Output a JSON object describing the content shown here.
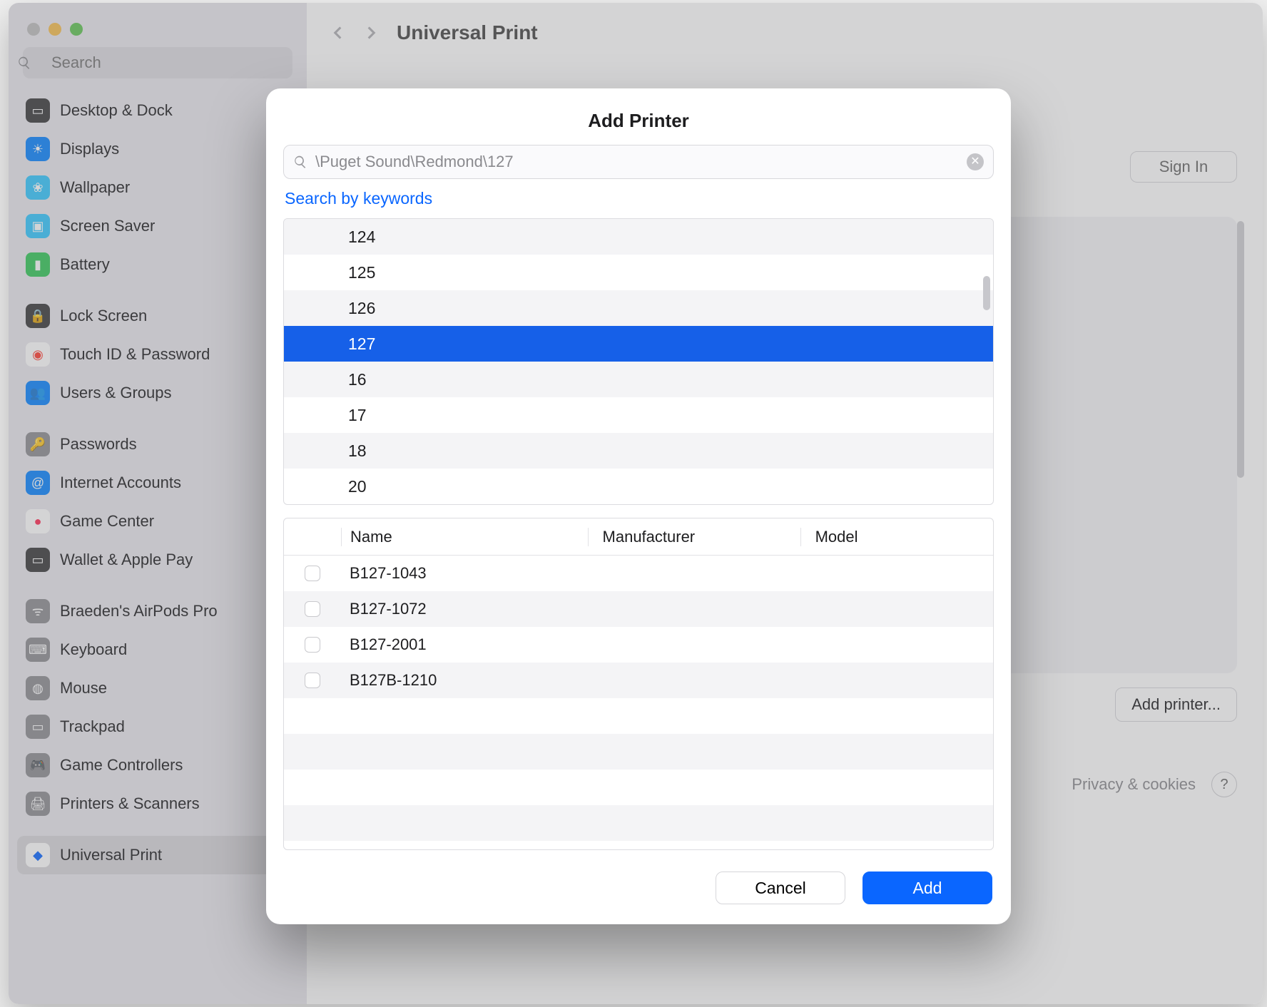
{
  "sidebar": {
    "search_placeholder": "Search",
    "items": [
      {
        "label": "Desktop & Dock",
        "bg": "#3a3a3c",
        "glyph": "▭"
      },
      {
        "label": "Displays",
        "bg": "#0a84ff",
        "glyph": "☀"
      },
      {
        "label": "Wallpaper",
        "bg": "#34c8ff",
        "glyph": "❀"
      },
      {
        "label": "Screen Saver",
        "bg": "#34c8ff",
        "glyph": "▣"
      },
      {
        "label": "Battery",
        "bg": "#34c759",
        "glyph": "▮"
      },
      {
        "gap": true
      },
      {
        "label": "Lock Screen",
        "bg": "#3a3a3c",
        "glyph": "🔒"
      },
      {
        "label": "Touch ID & Password",
        "bg": "#ffffff",
        "glyph": "◉",
        "glyphColor": "#ff3b30"
      },
      {
        "label": "Users & Groups",
        "bg": "#0a84ff",
        "glyph": "👥"
      },
      {
        "gap": true
      },
      {
        "label": "Passwords",
        "bg": "#8e8e93",
        "glyph": "🔑"
      },
      {
        "label": "Internet Accounts",
        "bg": "#0a84ff",
        "glyph": "@"
      },
      {
        "label": "Game Center",
        "bg": "#ffffff",
        "glyph": "●",
        "glyphColor": "#ff2d55"
      },
      {
        "label": "Wallet & Apple Pay",
        "bg": "#3a3a3c",
        "glyph": "▭"
      },
      {
        "gap": true
      },
      {
        "label": "Braeden's AirPods Pro",
        "bg": "#8e8e93",
        "glyph": "ᯤ"
      },
      {
        "label": "Keyboard",
        "bg": "#8e8e93",
        "glyph": "⌨"
      },
      {
        "label": "Mouse",
        "bg": "#8e8e93",
        "glyph": "◍"
      },
      {
        "label": "Trackpad",
        "bg": "#8e8e93",
        "glyph": "▭"
      },
      {
        "label": "Game Controllers",
        "bg": "#8e8e93",
        "glyph": "🎮"
      },
      {
        "label": "Printers & Scanners",
        "bg": "#8e8e93",
        "glyph": "🖨"
      },
      {
        "gap": true
      },
      {
        "label": "Universal Print",
        "bg": "#ffffff",
        "glyph": "◆",
        "glyphColor": "#0a66ff",
        "selected": true
      }
    ]
  },
  "content": {
    "title": "Universal Print",
    "signin_label": "Sign In",
    "add_printer_label": "Add printer...",
    "footer_text": "Privacy & cookies",
    "help_label": "?"
  },
  "dialog": {
    "title": "Add Printer",
    "search_value": "\\Puget Sound\\Redmond\\127",
    "keywords_link": "Search by keywords",
    "tree": [
      {
        "label": "124"
      },
      {
        "label": "125"
      },
      {
        "label": "126"
      },
      {
        "label": "127",
        "selected": true
      },
      {
        "label": "16"
      },
      {
        "label": "17"
      },
      {
        "label": "18"
      },
      {
        "label": "20"
      }
    ],
    "table": {
      "headers": {
        "name": "Name",
        "manufacturer": "Manufacturer",
        "model": "Model"
      },
      "rows": [
        {
          "name": "B127-1043",
          "manufacturer": "",
          "model": ""
        },
        {
          "name": "B127-1072",
          "manufacturer": "",
          "model": ""
        },
        {
          "name": "B127-2001",
          "manufacturer": "",
          "model": ""
        },
        {
          "name": "B127B-1210",
          "manufacturer": "",
          "model": ""
        }
      ]
    },
    "cancel_label": "Cancel",
    "add_label": "Add"
  }
}
